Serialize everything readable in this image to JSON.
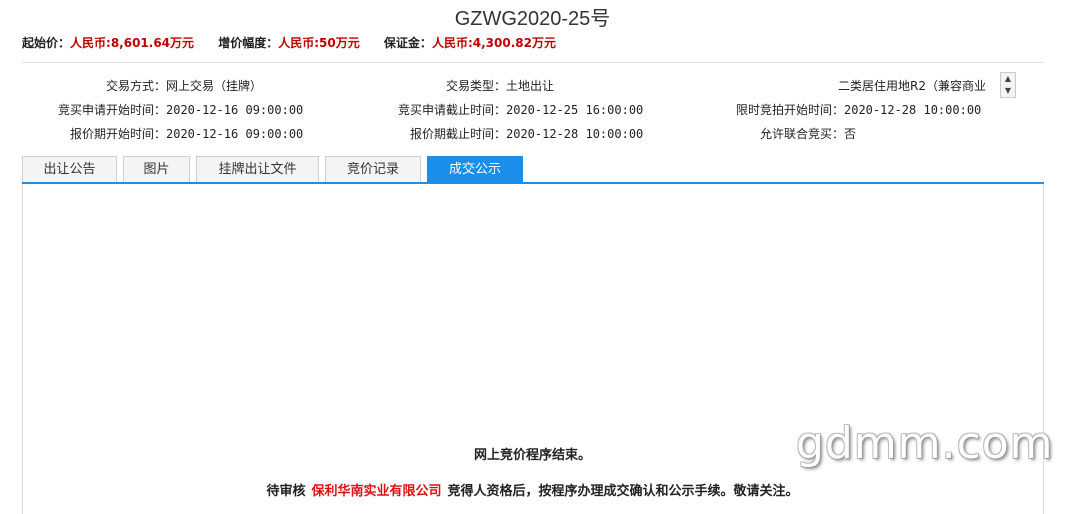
{
  "header": {
    "title": "GZWG2020-25号",
    "start_price_label": "起始价：",
    "start_price_value": "人民币:8,601.64万元",
    "increment_label": "增价幅度：",
    "increment_value": "人民币:50万元",
    "deposit_label": "保证金：",
    "deposit_value": "人民币:4,300.82万元"
  },
  "info": {
    "trade_method_label": "交易方式：",
    "trade_method_value": "网上交易（挂牌）",
    "trade_type_label": "交易类型：",
    "trade_type_value": "土地出让",
    "land_use_value": "二类居住用地R2（兼容商业",
    "apply_start_label": "竞买申请开始时间：",
    "apply_start_value": "2020-12-16 09:00:00",
    "apply_end_label": "竞买申请截止时间：",
    "apply_end_value": "2020-12-25 16:00:00",
    "auction_start_label": "限时竞拍开始时间：",
    "auction_start_value": "2020-12-28 10:00:00",
    "quote_start_label": "报价期开始时间：",
    "quote_start_value": "2020-12-16 09:00:00",
    "quote_end_label": "报价期截止时间：",
    "quote_end_value": "2020-12-28 10:00:00",
    "joint_label": "允许联合竞买：",
    "joint_value": "否"
  },
  "tabs": [
    {
      "label": "出让公告"
    },
    {
      "label": "图片"
    },
    {
      "label": "挂牌出让文件"
    },
    {
      "label": "竞价记录"
    },
    {
      "label": "成交公示",
      "active": true
    }
  ],
  "content": {
    "end_message": "网上竞价程序结束。",
    "notice_prefix": "待审核",
    "company": "保利华南实业有限公司",
    "notice_suffix": "竞得人资格后，按程序办理成交确认和公示手续。敬请关注。"
  },
  "watermark": "gdmm.com",
  "icons": {
    "scroll": "up-down-arrows-icon"
  },
  "colors": {
    "accent": "#1a8ee8",
    "price": "#c00000",
    "company": "#e01010"
  }
}
